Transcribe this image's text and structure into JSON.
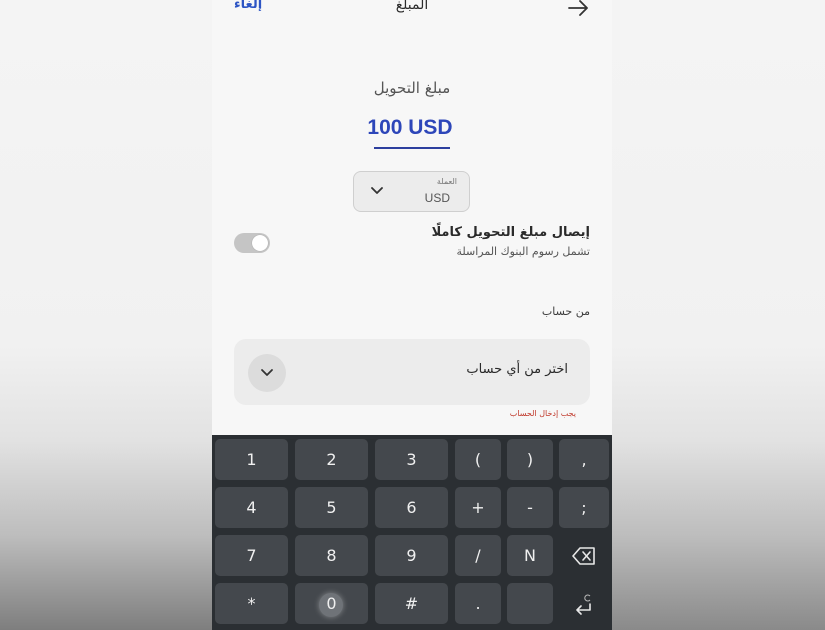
{
  "header": {
    "cancel_label": "إلغاء",
    "title": "المبلغ",
    "back_icon": "arrow-right-icon"
  },
  "amount": {
    "label": "مبلغ التحويل",
    "value": "100 USD"
  },
  "currency": {
    "caption": "العملة",
    "selected": "USD",
    "chevron_icon": "chevron-down-icon"
  },
  "full_transfer": {
    "title": "إيصال مبلغ التحويل كاملًا",
    "subtitle": "تشمل رسوم البنوك المراسلة",
    "enabled": false
  },
  "from_account": {
    "label": "من حساب",
    "placeholder": "اختر من أي حساب",
    "error": "يجب إدخال الحساب"
  },
  "keyboard": {
    "rows": [
      [
        "1",
        "2",
        "3",
        "(",
        ")",
        ","
      ],
      [
        "4",
        "5",
        "6",
        "+",
        "-",
        ";"
      ],
      [
        "7",
        "8",
        "9",
        "/",
        "N",
        "⌫"
      ],
      [
        "*",
        "0",
        "#",
        ".",
        "",
        "↵"
      ]
    ],
    "backspace_icon": "backspace-icon",
    "enter_icon": "enter-icon"
  },
  "colors": {
    "accent": "#2d46b9",
    "link": "#2d55c4",
    "error": "#c0392b",
    "keyboard_bg": "#2b2f33",
    "key_bg": "#44484d"
  }
}
